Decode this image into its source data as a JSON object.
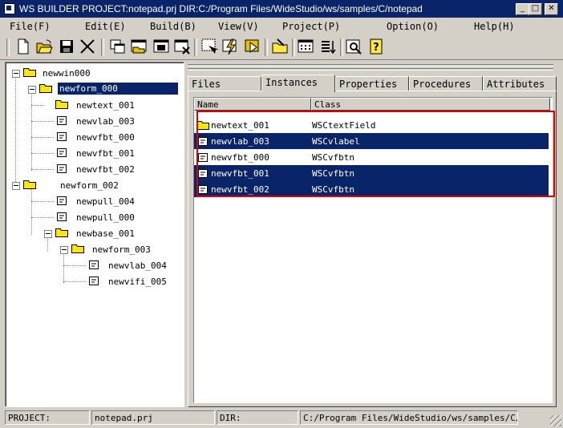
{
  "window": {
    "title": "WS BUILDER PROJECT:notepad.prj DIR:C:/Program Files/WideStudio/ws/samples/C/notepad",
    "buttons": {
      "minimize": "_",
      "maximize": "□",
      "close": "✕"
    }
  },
  "menu": [
    {
      "label": "File(F)"
    },
    {
      "label": "Edit(E)"
    },
    {
      "label": "Build(B)"
    },
    {
      "label": "View(V)"
    },
    {
      "label": "Project(P)"
    },
    {
      "label": "Option(O)"
    },
    {
      "label": "Help(H)"
    }
  ],
  "toolbar": [
    {
      "icon": "new-file-icon"
    },
    {
      "icon": "open-folder-icon"
    },
    {
      "icon": "save-icon"
    },
    {
      "icon": "cut-icon"
    },
    {
      "icon": "copy-window-icon"
    },
    {
      "icon": "open-window-icon"
    },
    {
      "icon": "save-window-icon"
    },
    {
      "icon": "delete-window-icon"
    },
    {
      "icon": "select-instance-icon"
    },
    {
      "icon": "build-lightning-icon"
    },
    {
      "icon": "run-icon"
    },
    {
      "icon": "folder-arrow-icon"
    },
    {
      "icon": "grid-icon"
    },
    {
      "icon": "list-icon"
    },
    {
      "icon": "preview-icon"
    },
    {
      "icon": "help-icon"
    }
  ],
  "tree": [
    {
      "label": "newwin000"
    },
    {
      "label": "newform_000",
      "selected": true
    },
    {
      "label": "newtext_001"
    },
    {
      "label": "newvlab_003"
    },
    {
      "label": "newvfbt_000"
    },
    {
      "label": "newvfbt_001"
    },
    {
      "label": "newvfbt_002"
    },
    {
      "label": "newform_002"
    },
    {
      "label": "newpull_004"
    },
    {
      "label": "newpull_000"
    },
    {
      "label": "newbase_001"
    },
    {
      "label": "newform_003"
    },
    {
      "label": "newvlab_004"
    },
    {
      "label": "newvifi_005"
    }
  ],
  "tabs": [
    {
      "label": "Files"
    },
    {
      "label": "Instances",
      "active": true
    },
    {
      "label": "Properties"
    },
    {
      "label": "Procedures"
    },
    {
      "label": "Attributes"
    }
  ],
  "list": {
    "columns": [
      "Name",
      "Class"
    ],
    "rows": [
      {
        "name": "newtext_001",
        "class": "WSCtextField",
        "icon": "folder",
        "selected": false
      },
      {
        "name": "newvlab_003",
        "class": "WSCvlabel",
        "icon": "doc",
        "selected": true
      },
      {
        "name": "newvfbt_000",
        "class": "WSCvfbtn",
        "icon": "doc",
        "selected": false
      },
      {
        "name": "newvfbt_001",
        "class": "WSCvfbtn",
        "icon": "doc",
        "selected": true
      },
      {
        "name": "newvfbt_002",
        "class": "WSCvfbtn",
        "icon": "doc",
        "selected": true
      }
    ]
  },
  "status": {
    "project_label": "PROJECT:",
    "project_value": "notepad.prj",
    "dir_label": "DIR:",
    "dir_value": "C:/Program Files/WideStudio/ws/samples/C/note"
  },
  "colors": {
    "selection": "#0a246a",
    "highlight_box": "#e00000",
    "face": "#d4d0c8"
  }
}
